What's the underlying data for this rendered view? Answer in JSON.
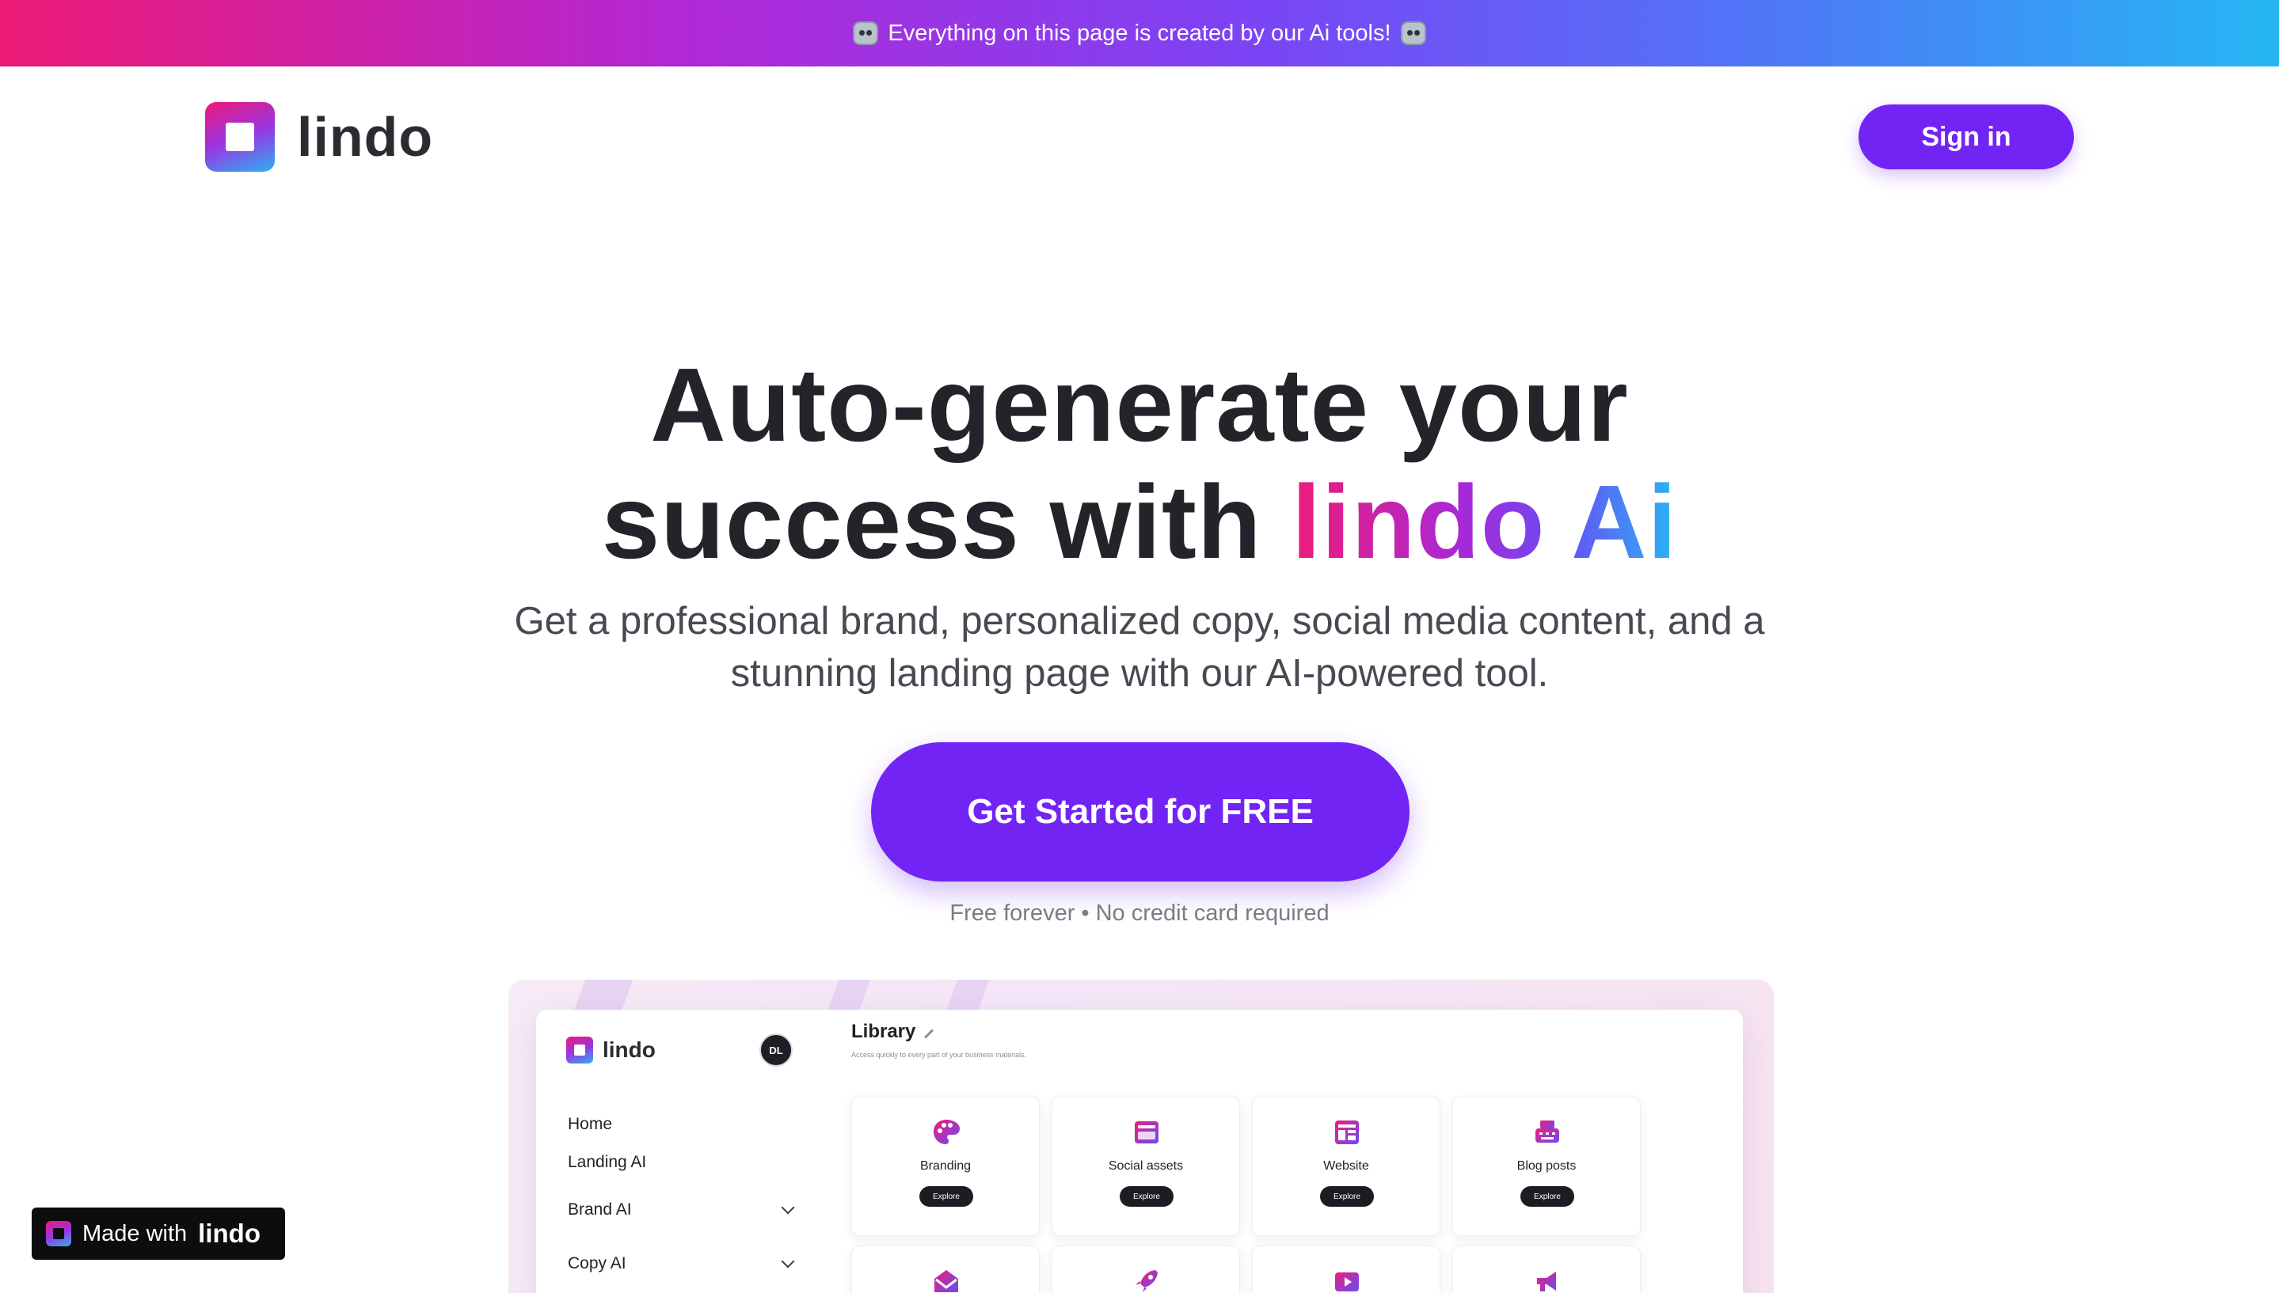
{
  "banner": {
    "text": "Everything on this page is created by our Ai tools!",
    "left_icon": "robot-icon",
    "right_icon": "robot-icon"
  },
  "header": {
    "brand": "lindo",
    "signin_label": "Sign in"
  },
  "hero": {
    "title_line1": "Auto-generate your",
    "title_line2_prefix": "success with",
    "title_line2_highlight": "lindo Ai",
    "subtitle": "Get a professional brand, personalized copy, social media content, and a stunning landing page with our AI-powered tool.",
    "cta_label": "Get Started for FREE",
    "cta_note": "Free forever • No credit card required"
  },
  "preview": {
    "brand": "lindo",
    "avatar_initials": "DL",
    "nav": [
      {
        "label": "Home",
        "expandable": false
      },
      {
        "label": "Landing AI",
        "expandable": false
      },
      {
        "label": "Brand AI",
        "expandable": true
      },
      {
        "label": "Copy AI",
        "expandable": true
      }
    ],
    "library_title": "Library",
    "library_subtitle": "Access quickly to every part of your business materials.",
    "cards": [
      {
        "label": "Branding",
        "button": "Explore",
        "icon": "palette-icon"
      },
      {
        "label": "Social assets",
        "button": "Explore",
        "icon": "social-assets-icon"
      },
      {
        "label": "Website",
        "button": "Explore",
        "icon": "website-icon"
      },
      {
        "label": "Blog posts",
        "button": "Explore",
        "icon": "typewriter-icon"
      }
    ],
    "second_row_icons": [
      "envelope-icon",
      "rocket-icon",
      "play-icon",
      "megaphone-icon"
    ]
  },
  "badge": {
    "prefix": "Made with",
    "brand": "lindo"
  },
  "colors": {
    "primary": "#7224f4",
    "gradient_start": "#ec1a74",
    "gradient_end": "#25b7f3",
    "text_dark": "#22242a"
  }
}
